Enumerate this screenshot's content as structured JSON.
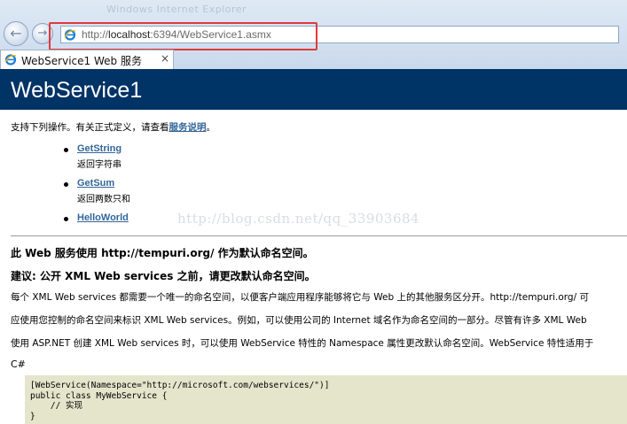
{
  "browser": {
    "window_title": "Windows Internet Explorer",
    "address_url_prefix": "http://",
    "address_url_host": "localhost",
    "address_url_rest": ":6394/WebService1.asmx",
    "tab_title": "WebService1 Web 服务",
    "tab_close": "×"
  },
  "page": {
    "heading": "WebService1",
    "intro_text": "支持下列操作。有关正式定义，请查看",
    "intro_link": "服务说明",
    "intro_end": "。",
    "operations": [
      {
        "name": "GetString",
        "desc": "返回字符串"
      },
      {
        "name": "GetSum",
        "desc": "返回两数只和"
      },
      {
        "name": "HelloWorld",
        "desc": ""
      }
    ],
    "watermark": "http://blog.csdn.net/qq_33903684",
    "namespace_heading": "此 Web 服务使用 http://tempuri.org/ 作为默认命名空间。",
    "namespace_advice": "建议: 公开 XML Web services 之前，请更改默认命名空间。",
    "paragraphs": [
      "每个 XML Web services 都需要一个唯一的命名空间，以便客户端应用程序能够将它与 Web 上的其他服务区分开。http://tempuri.org/ 可",
      "应使用您控制的命名空间来标识 XML Web services。例如，可以使用公司的 Internet 域名作为命名空间的一部分。尽管有许多 XML Web",
      "使用 ASP.NET 创建 XML Web services 时，可以使用 WebService 特性的 Namespace 属性更改默认命名空间。WebService 特性适用于"
    ],
    "code_language": "C#",
    "code_sample": "[WebService(Namespace=\"http://microsoft.com/webservices/\")]\npublic class MyWebService {\n    // 实现\n}"
  },
  "colors": {
    "banner": "#003366",
    "link": "#336699",
    "highlight": "#e03a3a",
    "code_bg": "#e5e5cc"
  }
}
